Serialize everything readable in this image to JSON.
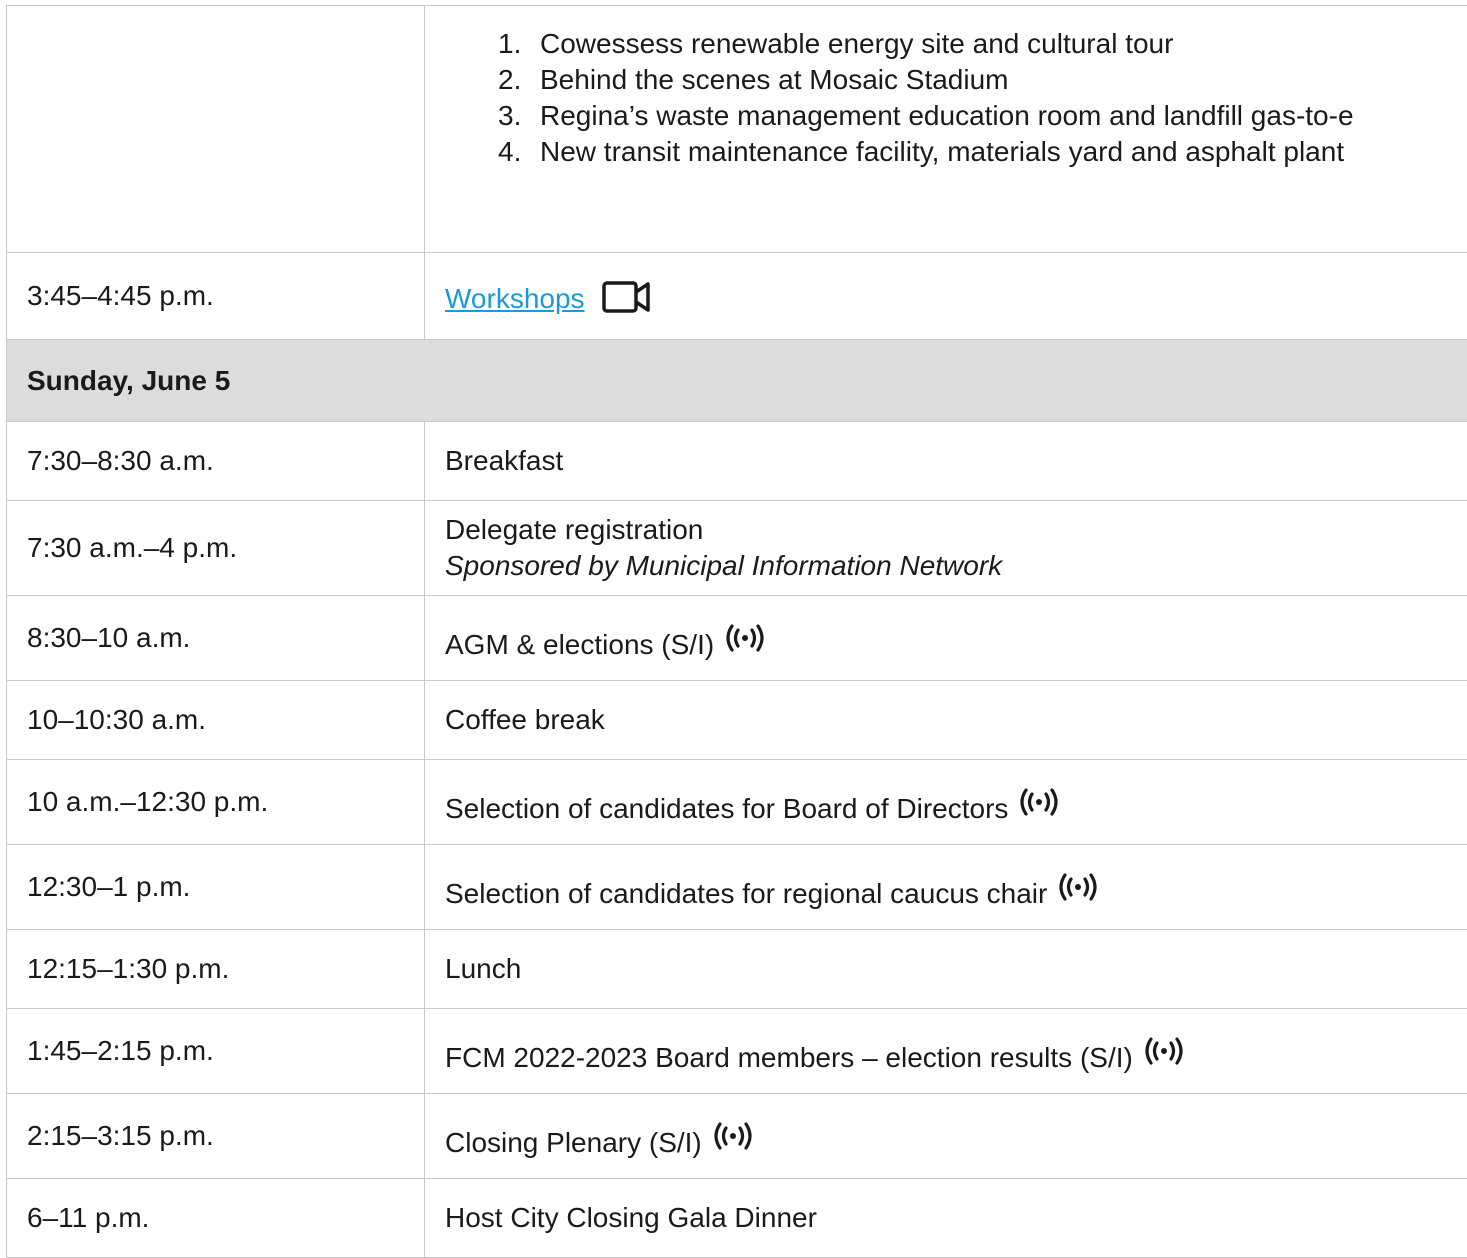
{
  "tours": [
    "Cowessess renewable energy site and cultural tour",
    "Behind the scenes at Mosaic Stadium",
    "Regina’s waste management education room and landfill gas-to-e",
    "New transit maintenance facility, materials yard and asphalt plant"
  ],
  "workshops": {
    "time": "3:45–4:45 p.m.",
    "label": "Workshops"
  },
  "day_header": "Sunday, June 5",
  "rows": [
    {
      "time": "7:30–8:30 a.m.",
      "event": "Breakfast"
    },
    {
      "time": "7:30 a.m.–4 p.m.",
      "event": "Delegate registration",
      "sponsor": "Sponsored by Municipal Information Network"
    },
    {
      "time": "8:30–10 a.m.",
      "event": "AGM & elections (S/I)",
      "icon": "live-broadcast-icon"
    },
    {
      "time": "10–10:30 a.m.",
      "event": "Coffee break"
    },
    {
      "time": "10 a.m.–12:30 p.m.",
      "event": "Selection of candidates for Board of Directors",
      "icon": "live-broadcast-icon"
    },
    {
      "time": "12:30–1 p.m.",
      "event": "Selection of candidates for regional caucus chair",
      "icon": "live-broadcast-icon"
    },
    {
      "time": "12:15–1:30 p.m.",
      "event": "Lunch"
    },
    {
      "time": "1:45–2:15 p.m.",
      "event": "FCM 2022-2023 Board members – election results (S/I)",
      "icon": "live-broadcast-icon"
    },
    {
      "time": "2:15–3:15 p.m.",
      "event": "Closing Plenary (S/I)",
      "icon": "live-broadcast-icon"
    },
    {
      "time": "6–11 p.m.",
      "event": "Host City Closing Gala Dinner"
    }
  ]
}
